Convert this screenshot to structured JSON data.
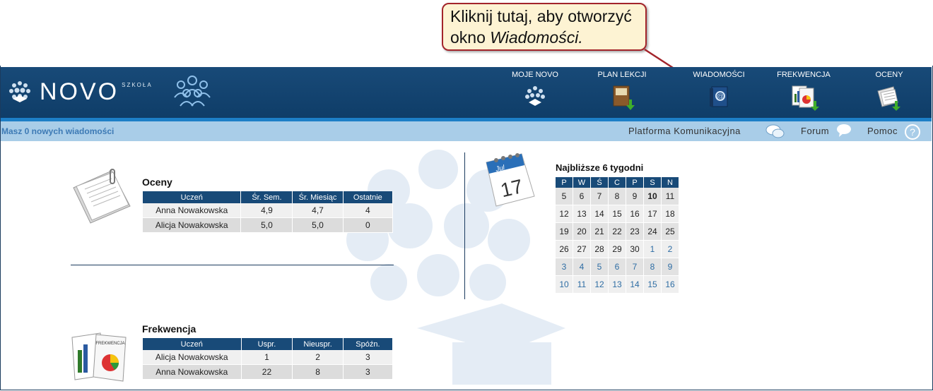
{
  "callout": {
    "line1": "Kliknij tutaj, aby otworzyć",
    "line2_prefix": "okno ",
    "line2_em": "Wiadomości."
  },
  "logo": {
    "text": "NOVO",
    "sub": "SZKOŁA"
  },
  "nav": [
    {
      "label": "MOJE NOVO",
      "icon": "globe-avatar-icon"
    },
    {
      "label": "PLAN LEKCJI",
      "icon": "schedule-book-icon"
    },
    {
      "label": "WIADOMOŚCI",
      "icon": "messages-book-icon"
    },
    {
      "label": "FREKWENCJA",
      "icon": "attendance-chart-icon"
    },
    {
      "label": "OCENY",
      "icon": "grades-documents-icon"
    }
  ],
  "subbar": {
    "message_count": "Masz 0 nowych wiadomości",
    "platform": "Platforma Komunikacyjna",
    "forum": "Forum",
    "help": "Pomoc"
  },
  "grades": {
    "title": "Oceny",
    "headers": [
      "Uczeń",
      "Śr. Sem.",
      "Śr. Miesiąc",
      "Ostatnie"
    ],
    "rows": [
      [
        "Anna Nowakowska",
        "4,9",
        "4,7",
        "4"
      ],
      [
        "Alicja Nowakowska",
        "5,0",
        "5,0",
        "0"
      ]
    ]
  },
  "attendance": {
    "title": "Frekwencja",
    "headers": [
      "Uczeń",
      "Uspr.",
      "Nieuspr.",
      "Spóźn."
    ],
    "rows": [
      [
        "Alicja Nowakowska",
        "1",
        "2",
        "3"
      ],
      [
        "Anna Nowakowska",
        "22",
        "8",
        "3"
      ]
    ]
  },
  "calendar": {
    "title": "Najbliższe 6 tygodni",
    "icon_month": "Jul",
    "icon_day": "17",
    "days": [
      "P",
      "W",
      "Ś",
      "C",
      "P",
      "S",
      "N"
    ],
    "weeks": [
      [
        "5",
        "6",
        "7",
        "8",
        "9",
        "10",
        "11"
      ],
      [
        "12",
        "13",
        "14",
        "15",
        "16",
        "17",
        "18"
      ],
      [
        "19",
        "20",
        "21",
        "22",
        "23",
        "24",
        "25"
      ],
      [
        "26",
        "27",
        "28",
        "29",
        "30",
        "1",
        "2"
      ],
      [
        "3",
        "4",
        "5",
        "6",
        "7",
        "8",
        "9"
      ],
      [
        "10",
        "11",
        "12",
        "13",
        "14",
        "15",
        "16"
      ]
    ],
    "today": "10",
    "colors": {
      "header": "#184a78",
      "next_month": "#2e6da4"
    }
  },
  "colors": {
    "header_bg": "#184a78",
    "accent_stripe": "#1d7fc7",
    "subbar_bg": "#a9cde8",
    "callout_border": "#a3242b"
  }
}
